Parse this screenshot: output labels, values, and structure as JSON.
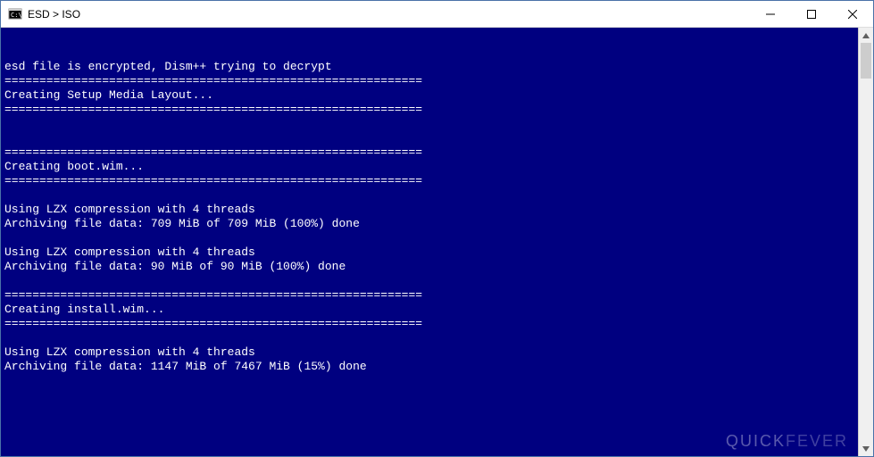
{
  "window": {
    "title": "ESD > ISO"
  },
  "console": {
    "lines": [
      "",
      "",
      "esd file is encrypted, Dism++ trying to decrypt",
      "============================================================",
      "Creating Setup Media Layout...",
      "============================================================",
      "",
      "",
      "============================================================",
      "Creating boot.wim...",
      "============================================================",
      "",
      "Using LZX compression with 4 threads",
      "Archiving file data: 709 MiB of 709 MiB (100%) done",
      "",
      "Using LZX compression with 4 threads",
      "Archiving file data: 90 MiB of 90 MiB (100%) done",
      "",
      "============================================================",
      "Creating install.wim...",
      "============================================================",
      "",
      "Using LZX compression with 4 threads",
      "Archiving file data: 1147 MiB of 7467 MiB (15%) done"
    ]
  },
  "watermark": {
    "part1": "QUICK",
    "part2": "FEVER"
  }
}
